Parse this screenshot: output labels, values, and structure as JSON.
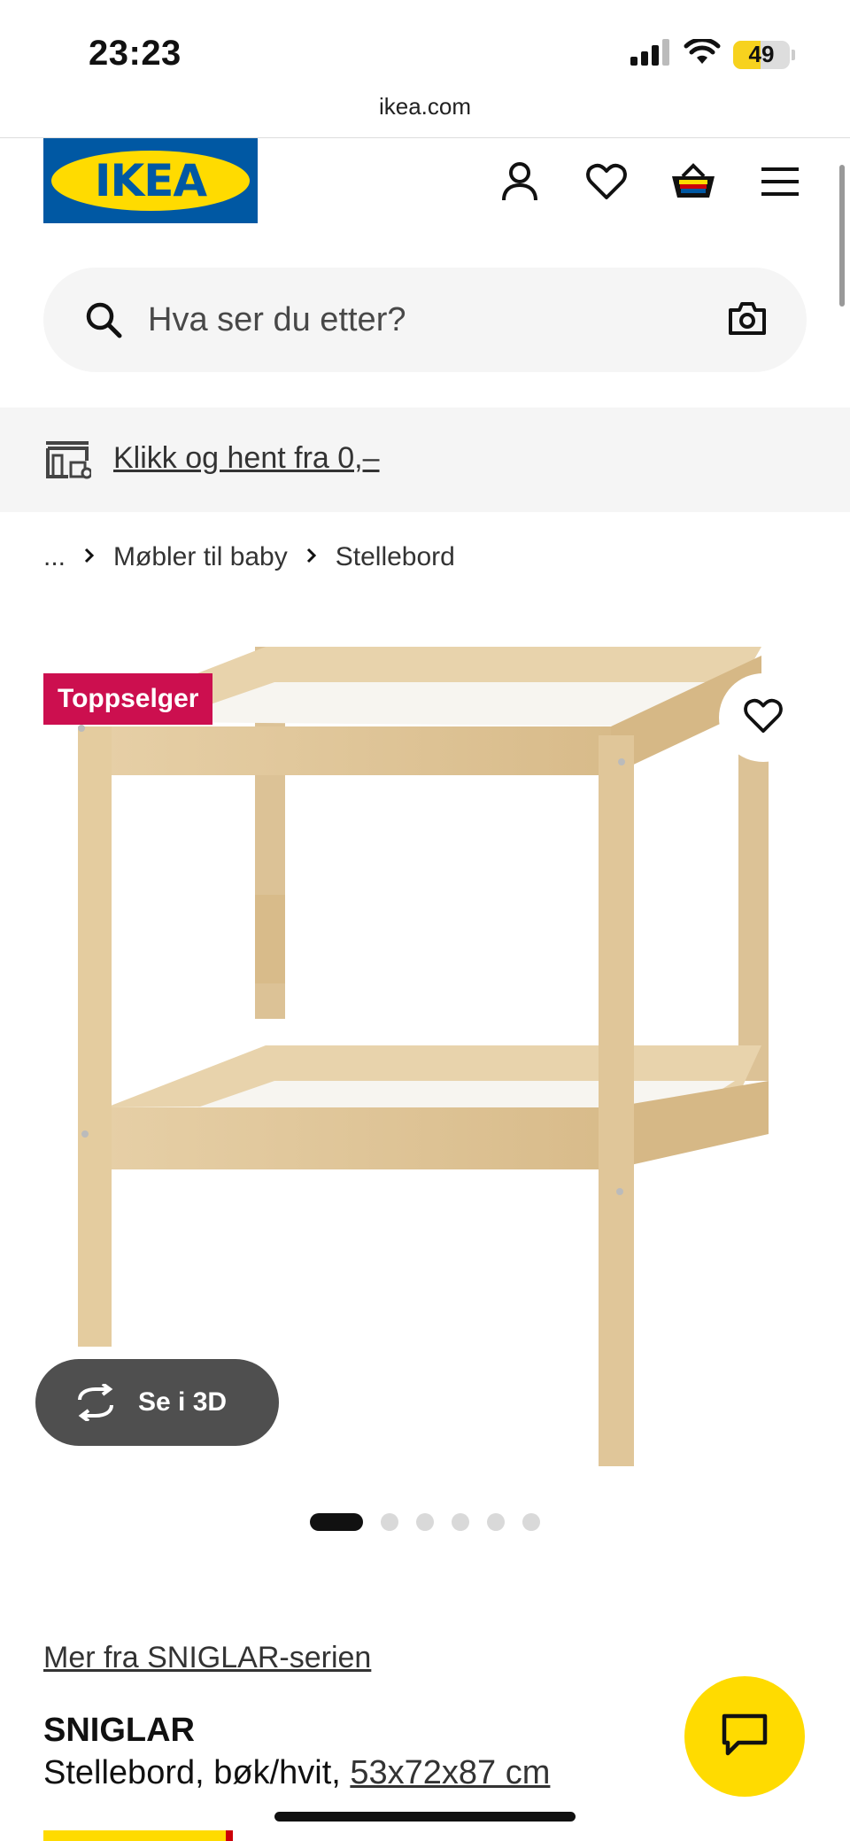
{
  "status_bar": {
    "time": "23:23",
    "battery": "49",
    "battery_level": 0.49
  },
  "browser": {
    "url": "ikea.com"
  },
  "header": {
    "logo_text": "IKEA",
    "icons": [
      "person-icon",
      "heart-icon",
      "basket-icon",
      "menu-icon"
    ]
  },
  "search": {
    "placeholder": "Hva ser du etter?",
    "value": ""
  },
  "promo": {
    "label": "Klikk og hent fra 0,–"
  },
  "breadcrumb": {
    "ellipsis": "...",
    "items": [
      "Møbler til baby",
      "Stellebord"
    ]
  },
  "product": {
    "badge": "Toppselger",
    "see_3d_label": "Se i 3D",
    "image_count": 6,
    "active_image": 1,
    "series_link": "Mer fra SNIGLAR-serien",
    "name": "SNIGLAR",
    "description": "Stellebord, bøk/hvit,",
    "dimensions": "53x72x87 cm"
  },
  "colors": {
    "ikea_blue": "#0058a3",
    "ikea_yellow": "#ffdb00",
    "badge_red": "#cc0f4f"
  }
}
